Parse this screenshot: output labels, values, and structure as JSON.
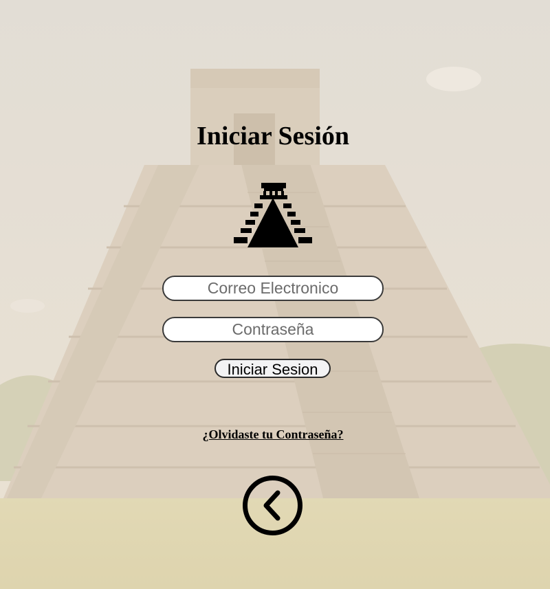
{
  "page": {
    "title": "Iniciar Sesión"
  },
  "form": {
    "email_placeholder": "Correo Electronico",
    "email_value": "",
    "password_placeholder": "Contraseña",
    "password_value": "",
    "submit_label": "Iniciar Sesion",
    "forgot_label": "¿Olvidaste tu Contraseña?"
  },
  "icons": {
    "logo": "pyramid-icon",
    "back": "chevron-left-circle-icon"
  },
  "colors": {
    "text": "#000000",
    "input_bg": "#ffffff",
    "button_bg": "#f3f3f4",
    "overlay": "#f2e8d9"
  }
}
